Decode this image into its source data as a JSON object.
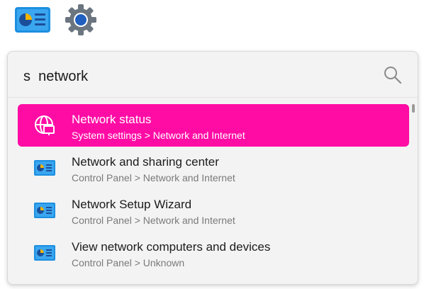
{
  "top_icons": [
    {
      "name": "control-panel-icon"
    },
    {
      "name": "settings-gear-icon"
    }
  ],
  "search": {
    "query": "s  network",
    "icon": "search-icon"
  },
  "results": [
    {
      "title": "Network status",
      "subtitle": "System settings > Network and Internet",
      "icon": "globe-icon",
      "selected": true
    },
    {
      "title": "Network and sharing center",
      "subtitle": "Control Panel > Network and Internet",
      "icon": "control-panel-icon",
      "selected": false
    },
    {
      "title": "Network Setup Wizard",
      "subtitle": "Control Panel > Network and Internet",
      "icon": "control-panel-icon",
      "selected": false
    },
    {
      "title": "View network computers and devices",
      "subtitle": "Control Panel > Unknown",
      "icon": "control-panel-icon",
      "selected": false
    }
  ],
  "colors": {
    "selected_background": "#ff0ca5",
    "panel_background": "#f3f3f3"
  }
}
